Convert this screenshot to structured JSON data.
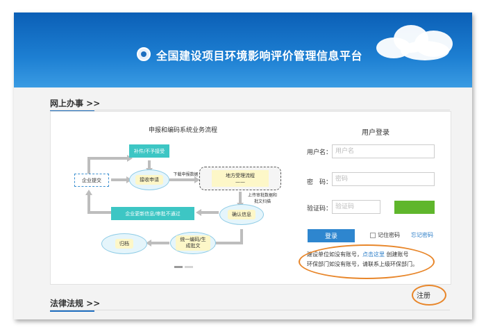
{
  "header": {
    "title": "全国建设项目环境影响评价管理信息平台",
    "logo_icon": "emblem-icon"
  },
  "sections": {
    "online": "网上办事 >>",
    "law": "法律法规 >>"
  },
  "flow": {
    "title": "申报和编码系统业务流程",
    "nodes": {
      "supplement": "补件/不予接受",
      "submit": "企业提交",
      "receive": "接收申请",
      "download": "下载申报数据",
      "local": "地方受理流程",
      "local_sub": "——",
      "upload": "上传审批数据和",
      "upload2": "批文扫描",
      "confirm": "确认信息",
      "update": "企业更新信息/审批不通过",
      "unified": "统一编码/生",
      "unified2": "成批文",
      "archive": "归档"
    }
  },
  "login": {
    "title": "用户登录",
    "username_label": "用户名：",
    "username_placeholder": "用户名",
    "password_label": "密　码：",
    "password_placeholder": "密码",
    "captcha_label": "验证码：",
    "captcha_placeholder": "验证码",
    "login_button": "登录",
    "remember": "记住密码",
    "forgot": "忘记密码"
  },
  "info": {
    "line1_pre": "建设单位如没有账号，",
    "line1_link": "点击这里",
    "line1_post": " 创建账号",
    "line2": "环保部门如没有账号，请联系上级环保部门。"
  },
  "annotation": {
    "register": "注册"
  },
  "colors": {
    "header": "#1d7fd2",
    "teal": "#3dc6c4",
    "accent": "#e8862a",
    "button": "#2e86cf",
    "captcha": "#5fb62c"
  }
}
